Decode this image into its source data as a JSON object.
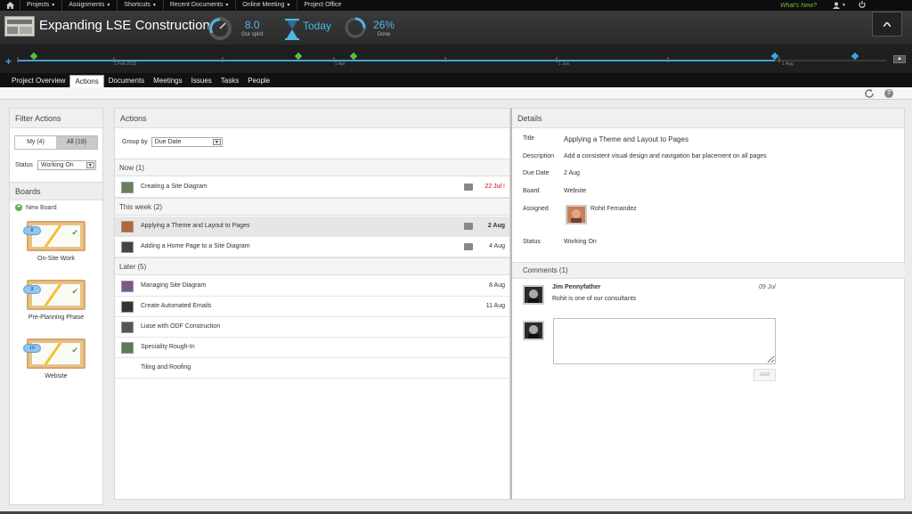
{
  "topnav": {
    "menu": [
      "Projects",
      "Assignments",
      "Shortcuts",
      "Recent Documents",
      "Online Meeting",
      "Project Office"
    ],
    "menu_caret": [
      true,
      true,
      true,
      true,
      true,
      false
    ],
    "whats_new": "What's New?"
  },
  "header": {
    "title": "Expanding LSE Construction",
    "spirit_value": "8.0",
    "spirit_label": "Our spirit",
    "today_label": "Today",
    "done_value": "26%",
    "done_label": "Done",
    "done_fraction": 0.26
  },
  "timeline": {
    "labels": [
      "1 Feb 2012",
      "1 Apr",
      "1 Jun",
      "1 Aug"
    ]
  },
  "tabs": [
    "Project Overview",
    "Actions",
    "Documents",
    "Meetings",
    "Issues",
    "Tasks",
    "People"
  ],
  "active_tab": "Actions",
  "filter": {
    "title": "Filter Actions",
    "my_label": "My (4)",
    "all_label": "All (19)",
    "status_label": "Status",
    "status_value": "Working On"
  },
  "boards": {
    "title": "Boards",
    "new_label": "New Board",
    "items": [
      {
        "name": "On-Site Work",
        "count": "8"
      },
      {
        "name": "Pre-Planning Phase",
        "count": "9"
      },
      {
        "name": "Website",
        "count": "10"
      }
    ]
  },
  "actions": {
    "title": "Actions",
    "group_by_label": "Group by",
    "group_by_value": "Due Date",
    "groups": [
      {
        "label": "Now (1)",
        "rows": [
          {
            "name": "Creating a Site Diagram",
            "due": "22 Jul !",
            "comment": true,
            "style": "red",
            "avatar": "#6a7f5a"
          }
        ]
      },
      {
        "label": "This week (2)",
        "rows": [
          {
            "name": "Applying a Theme and Layout to Pages",
            "due": "2 Aug",
            "comment": true,
            "style": "bold",
            "avatar": "#b4643a",
            "selected": true
          },
          {
            "name": "Adding a Home Page to a Site Diagram",
            "due": "4 Aug",
            "comment": true,
            "style": "",
            "avatar": "#444"
          }
        ]
      },
      {
        "label": "Later (5)",
        "rows": [
          {
            "name": "Managing Site Diagram",
            "due": "8 Aug",
            "comment": false,
            "style": "",
            "avatar": "#7a5a8a"
          },
          {
            "name": "Create Automated Emails",
            "due": "11 Aug",
            "comment": false,
            "style": "",
            "avatar": "#333"
          },
          {
            "name": "Liase with ODF Construction",
            "due": "",
            "comment": false,
            "style": "",
            "avatar": "#555"
          },
          {
            "name": "Speciality Rough-In",
            "due": "",
            "comment": false,
            "style": "",
            "avatar": "#5a7a5a"
          },
          {
            "name": "Tiling and Roofing",
            "due": "",
            "comment": false,
            "style": "",
            "avatar": ""
          }
        ]
      }
    ]
  },
  "details": {
    "title": "Details",
    "title_label": "Title",
    "title_value": "Applying a Theme and Layout to Pages",
    "description_label": "Description",
    "description_value": "Add a consistent visual design and navigation bar placement on all pages",
    "due_label": "Due Date",
    "due_value": "2 Aug",
    "board_label": "Board",
    "board_value": "Website",
    "assigned_label": "Assigned",
    "assigned_value": "Rohit Fernandez",
    "status_label": "Status",
    "status_value": "Working On"
  },
  "comments": {
    "title": "Comments (1)",
    "author": "Jim Pennyfather",
    "date": "09 Jul",
    "text": "Rohit is one of our consultants",
    "add_label": "Add"
  }
}
